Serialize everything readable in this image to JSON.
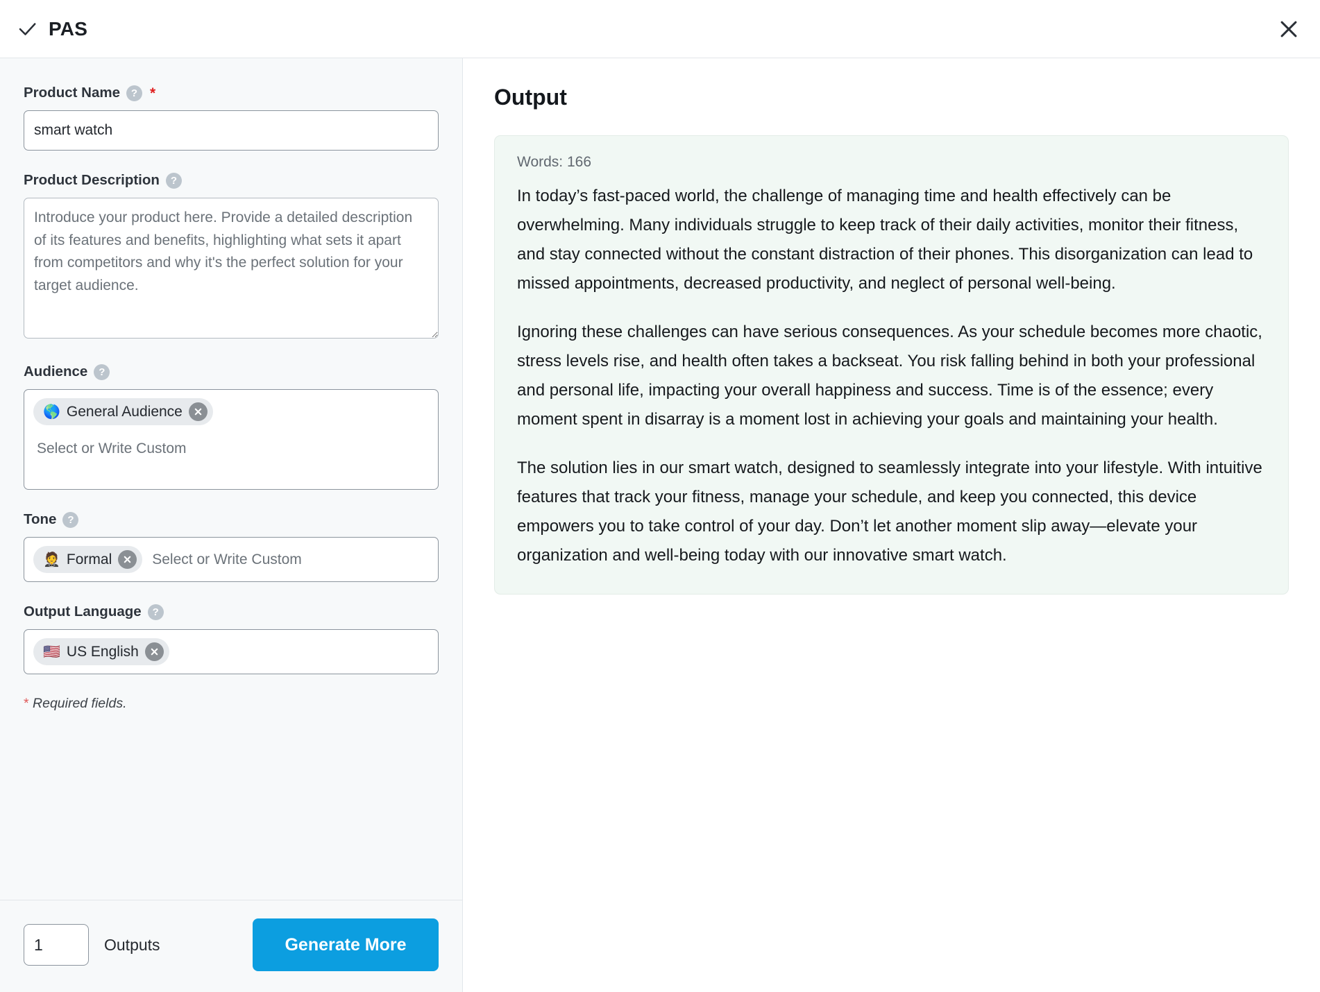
{
  "header": {
    "title": "PAS",
    "check_icon": "check-icon",
    "close_icon": "close-icon"
  },
  "form": {
    "product_name": {
      "label": "Product Name",
      "help_icon": "question-mark-icon",
      "required_marker": "*",
      "value": "smart watch"
    },
    "product_description": {
      "label": "Product Description",
      "help_icon": "question-mark-icon",
      "value": "",
      "placeholder": "Introduce your product here. Provide a detailed description of its features and benefits, highlighting what sets it apart from competitors and why it's the perfect solution for your target audience."
    },
    "audience": {
      "label": "Audience",
      "help_icon": "question-mark-icon",
      "placeholder": "Select or Write Custom",
      "chips": [
        {
          "emoji": "🌎",
          "label": "General Audience",
          "remove_icon": "close-circle-icon"
        }
      ]
    },
    "tone": {
      "label": "Tone",
      "help_icon": "question-mark-icon",
      "placeholder": "Select or Write Custom",
      "chips": [
        {
          "emoji": "🤵",
          "label": "Formal",
          "remove_icon": "close-circle-icon"
        }
      ]
    },
    "output_language": {
      "label": "Output Language",
      "help_icon": "question-mark-icon",
      "placeholder": "",
      "chips": [
        {
          "emoji": "🇺🇸",
          "label": "US English",
          "remove_icon": "close-circle-icon"
        }
      ]
    },
    "required_note_star": "*",
    "required_note": " Required fields."
  },
  "footer": {
    "outputs_value": "1",
    "outputs_label": "Outputs",
    "generate_label": "Generate More",
    "button_color": "#0c9ee0"
  },
  "output": {
    "title": "Output",
    "word_count": "Words: 166",
    "card_background": "#f1f8f4",
    "paragraphs": [
      "In today’s fast-paced world, the challenge of managing time and health effectively can be overwhelming. Many individuals struggle to keep track of their daily activities, monitor their fitness, and stay connected without the constant distraction of their phones. This disorganization can lead to missed appointments, decreased productivity, and neglect of personal well-being.",
      "Ignoring these challenges can have serious consequences. As your schedule becomes more chaotic, stress levels rise, and health often takes a backseat. You risk falling behind in both your professional and personal life, impacting your overall happiness and success. Time is of the essence; every moment spent in disarray is a moment lost in achieving your goals and maintaining your health.",
      "The solution lies in our smart watch, designed to seamlessly integrate into your lifestyle. With intuitive features that track your fitness, manage your schedule, and keep you connected, this device empowers you to take control of your day. Don’t let another moment slip away—elevate your organization and well-being today with our innovative smart watch."
    ]
  }
}
